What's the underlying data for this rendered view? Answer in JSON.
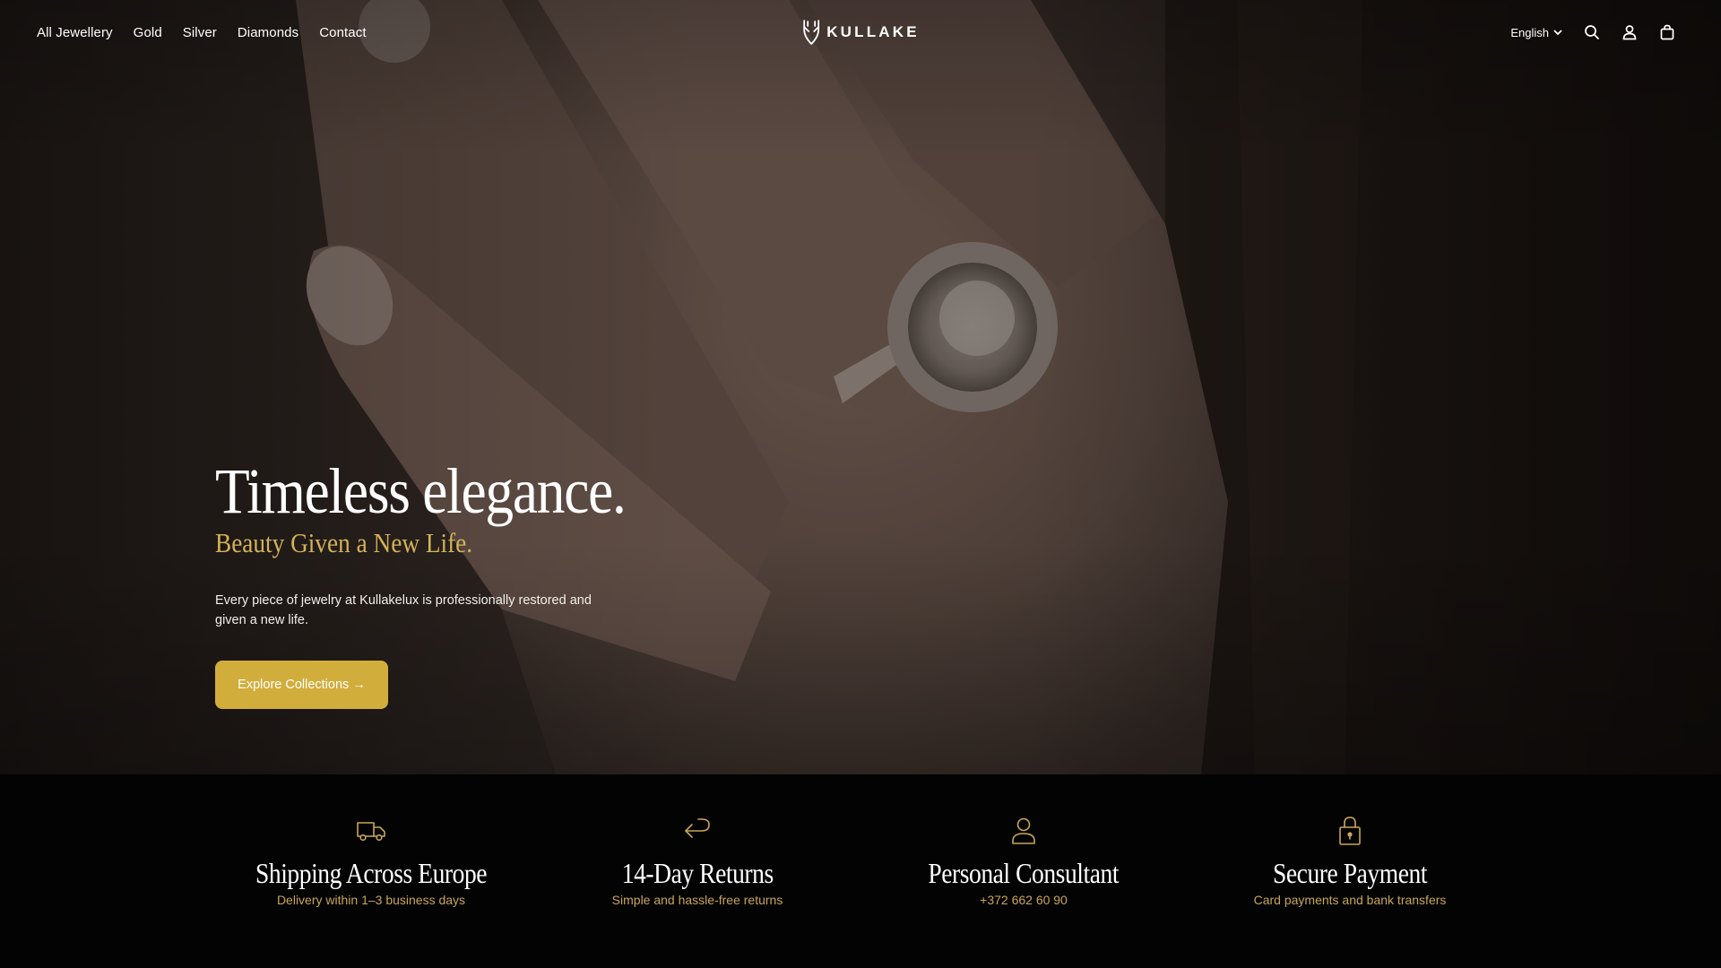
{
  "colors": {
    "accent_gold": "#d1ad3c",
    "subtitle_gold": "#d4b25a",
    "feature_sub_gold": "#c9a659",
    "features_bg": "#030303",
    "text_white": "#ffffff"
  },
  "header": {
    "nav": [
      "All Jewellery",
      "Gold",
      "Silver",
      "Diamonds",
      "Contact"
    ],
    "logo_text": "KULLAKE",
    "logo_icon": "antler-icon",
    "language": "English",
    "icons": [
      "search-icon",
      "account-icon",
      "shopping-bag-icon"
    ]
  },
  "hero": {
    "title": "Timeless elegance.",
    "subtitle": "Beauty Given a New Life.",
    "text": "Every piece of jewelry at Kullakelux is professionally restored and given a new life.",
    "cta_label": "Explore Collections →"
  },
  "features": [
    {
      "icon": "truck-icon",
      "title": "Shipping Across Europe",
      "subtitle": "Delivery within 1–3 business days"
    },
    {
      "icon": "return-arrow-icon",
      "title": "14-Day Returns",
      "subtitle": "Simple and hassle-free returns"
    },
    {
      "icon": "person-icon",
      "title": "Personal Consultant",
      "subtitle": "+372 662 60 90"
    },
    {
      "icon": "lock-icon",
      "title": "Secure Payment",
      "subtitle": "Card payments and bank transfers"
    }
  ]
}
